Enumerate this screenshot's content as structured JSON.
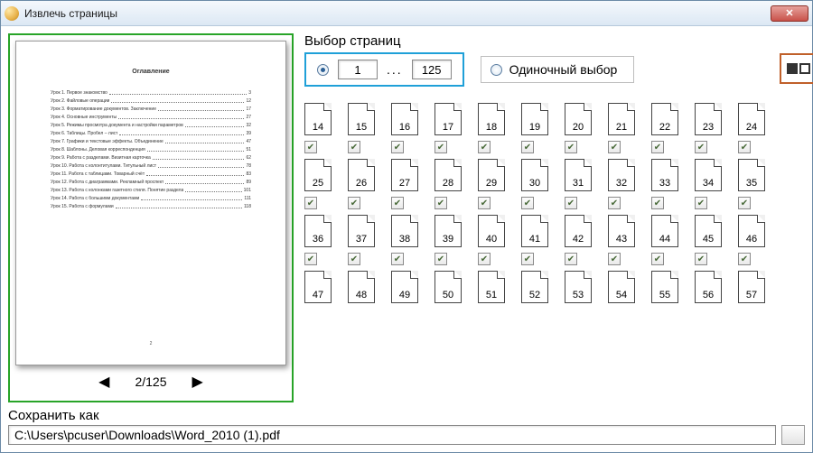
{
  "window": {
    "title": "Извлечь страницы",
    "close_glyph": "✕"
  },
  "preview": {
    "doc_heading": "Оглавление",
    "toc": [
      {
        "t": "Урок 1. Первое знакомство",
        "p": "3"
      },
      {
        "t": "Урок 2. Файловые операции",
        "p": "12"
      },
      {
        "t": "Урок 3. Форматирование документов. Заключение",
        "p": "17"
      },
      {
        "t": "Урок 4. Основные инструменты",
        "p": "27"
      },
      {
        "t": "Урок 5. Режимы просмотра документа и настройки параметров",
        "p": "32"
      },
      {
        "t": "Урок 6. Таблицы. Пробел – лист",
        "p": "39"
      },
      {
        "t": "Урок 7. Графики и текстовые эффекты. Объединение",
        "p": "47"
      },
      {
        "t": "Урок 8. Шаблоны. Деловая корреспонденция",
        "p": "51"
      },
      {
        "t": "Урок 9. Работа с разделами. Визитная карточка",
        "p": "62"
      },
      {
        "t": "Урок 10. Работа с колонтитулами. Титульный лист",
        "p": "78"
      },
      {
        "t": "Урок 11. Работа с таблицами. Товарный счёт",
        "p": "83"
      },
      {
        "t": "Урок 12. Работа с диаграммами. Рекламный проспект",
        "p": "89"
      },
      {
        "t": "Урок 13. Работа с колонками газетного стиля. Понятие раздела",
        "p": "101"
      },
      {
        "t": "Урок 14. Работа с большими документами",
        "p": "111"
      },
      {
        "t": "Урок 15. Работа с формулами",
        "p": "118"
      }
    ],
    "page_footer": "2",
    "pager": {
      "prev_glyph": "◀",
      "label": "2/125",
      "next_glyph": "▶"
    }
  },
  "selection": {
    "header": "Выбор страниц",
    "range_from": "1",
    "range_to": "125",
    "range_sep": "...",
    "single_label": "Одиночный выбор",
    "check_glyph": "✔",
    "rows": [
      [
        14,
        15,
        16,
        17,
        18,
        19,
        20,
        21,
        22,
        23,
        24
      ],
      [
        25,
        26,
        27,
        28,
        29,
        30,
        31,
        32,
        33,
        34,
        35
      ],
      [
        36,
        37,
        38,
        39,
        40,
        41,
        42,
        43,
        44,
        45,
        46
      ],
      [
        47,
        48,
        49,
        50,
        51,
        52,
        53,
        54,
        55,
        56,
        57
      ]
    ]
  },
  "save": {
    "label": "Сохранить как",
    "path": "C:\\Users\\pcuser\\Downloads\\Word_2010 (1).pdf"
  }
}
